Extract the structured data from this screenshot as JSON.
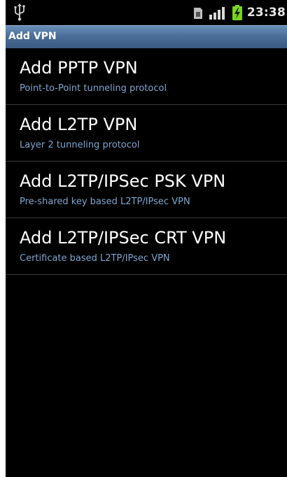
{
  "status_bar": {
    "time": "23:38",
    "icons": [
      "usb-icon",
      "sim-card-icon",
      "signal-bars-icon",
      "battery-charging-icon"
    ]
  },
  "title_bar": {
    "title": "Add VPN"
  },
  "vpn_types": [
    {
      "title": "Add PPTP VPN",
      "summary": "Point-to-Point tunneling protocol"
    },
    {
      "title": "Add L2TP VPN",
      "summary": "Layer 2 tunneling protocol"
    },
    {
      "title": "Add L2TP/IPSec PSK VPN",
      "summary": "Pre-shared key based L2TP/IPsec VPN"
    },
    {
      "title": "Add L2TP/IPSec CRT VPN",
      "summary": "Certificate based L2TP/IPsec VPN"
    }
  ],
  "colors": {
    "background": "#000000",
    "title_bar": "#4a6e98",
    "summary_text": "#7fa6d0",
    "battery": "#7ad321"
  }
}
